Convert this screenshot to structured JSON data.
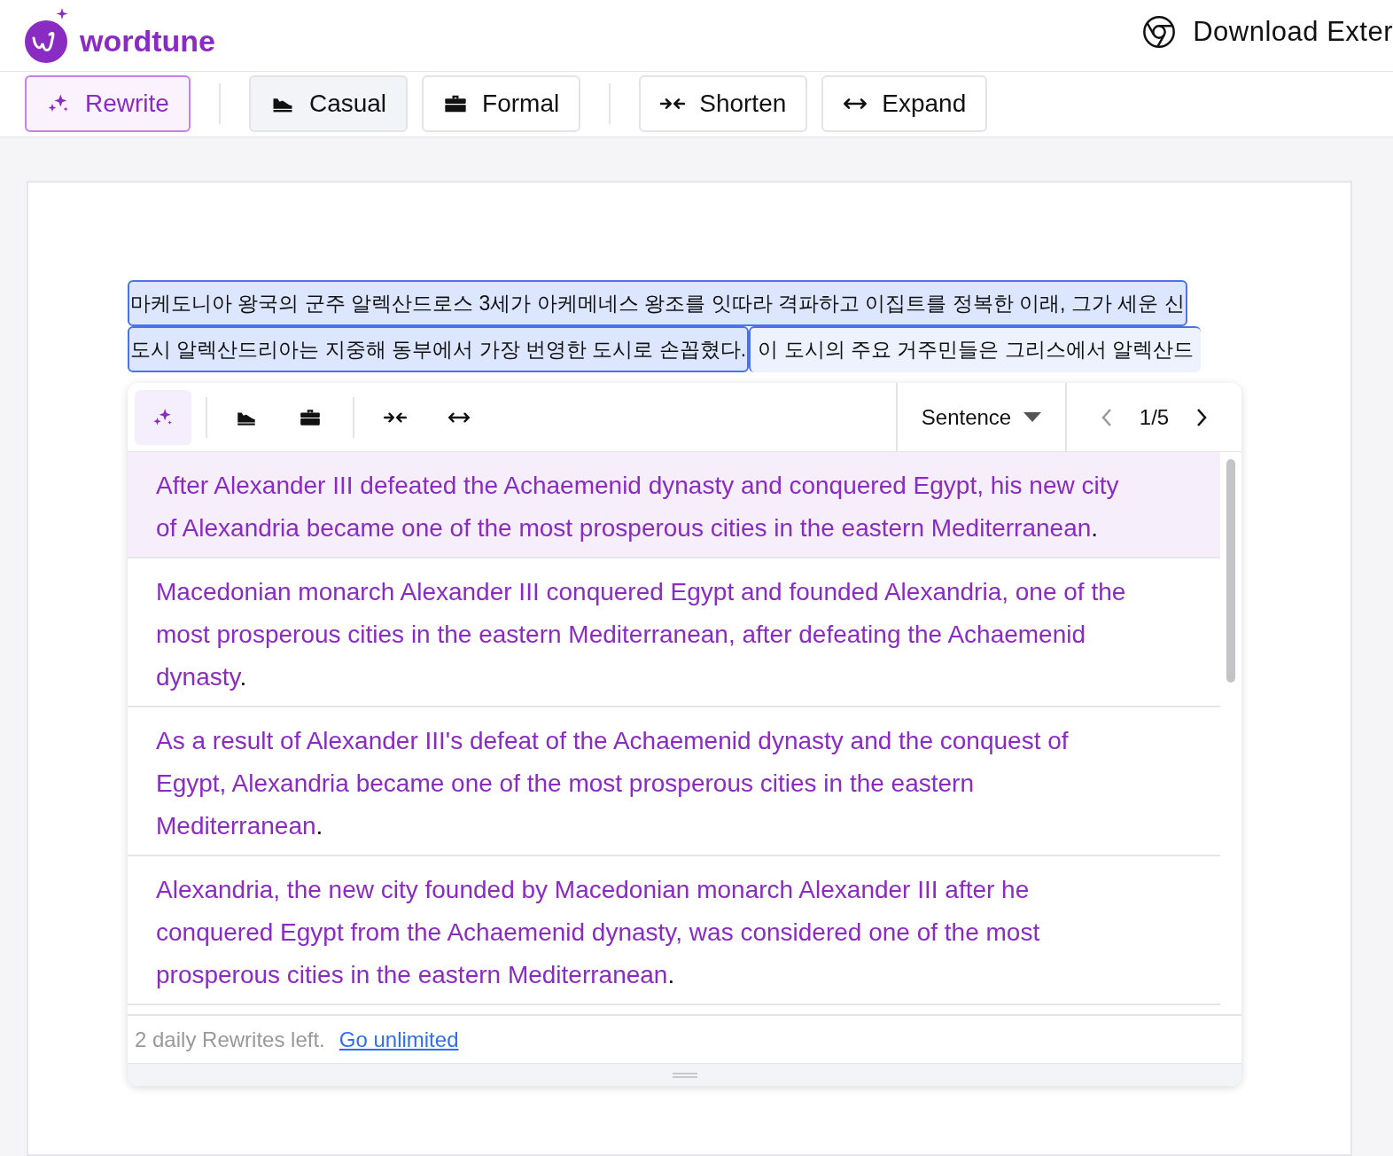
{
  "header": {
    "brand": "wordtune",
    "download_label": "Download Exter"
  },
  "toolbar": [
    {
      "kind": "rewrite",
      "label": "Rewrite",
      "selected": true
    },
    {
      "kind": "casual",
      "label": "Casual",
      "selected": false
    },
    {
      "kind": "formal",
      "label": "Formal",
      "selected": false
    },
    {
      "kind": "shorten",
      "label": "Shorten",
      "selected": false
    },
    {
      "kind": "expand",
      "label": "Expand",
      "selected": false
    }
  ],
  "editor": {
    "sentences": [
      {
        "selected": true,
        "lines": [
          "마케도니아 왕국의 군주 알렉산드로스 3세가 아케메네스 왕조를 잇따라 격파하고 이집트를 정복한 이래, 그가 세운 신",
          "도시 알렉산드리아는 지중해 동부에서 가장 번영한 도시로 손꼽혔다."
        ]
      },
      {
        "selected": false,
        "lines": [
          "이 도시의 주요 거주민들은 그리스에서 알렉산드"
        ]
      }
    ]
  },
  "popup": {
    "tools": [
      {
        "kind": "rewrite",
        "selected": true
      },
      {
        "kind": "casual",
        "selected": false
      },
      {
        "kind": "formal",
        "selected": false
      },
      {
        "kind": "shorten",
        "selected": false
      },
      {
        "kind": "expand",
        "selected": false
      }
    ],
    "mode": "Sentence",
    "pager": "1/5",
    "suggestions": [
      {
        "text": "After Alexander III defeated the Achaemenid dynasty and conquered Egypt, his new city of Alexandria became one of the most prosperous cities in the eastern Mediterranean",
        "end": ".",
        "selected": true
      },
      {
        "text": "Macedonian monarch Alexander III conquered Egypt and founded Alexandria, one of the most prosperous cities in the eastern Mediterranean, after defeating the Achaemenid dynasty",
        "end": ".",
        "selected": false
      },
      {
        "text": "As a result of Alexander III's defeat of the Achaemenid dynasty and the conquest of Egypt, Alexandria became one of the most prosperous cities in the eastern Mediterranean",
        "end": ".",
        "selected": false
      },
      {
        "text": "Alexandria, the new city founded by Macedonian monarch Alexander III after he conquered Egypt from the Achaemenid dynasty, was considered one of the most prosperous cities in the eastern Mediterranean",
        "end": ".",
        "selected": false
      }
    ],
    "footer_note": "2 daily Rewrites left.",
    "footer_link": "Go unlimited"
  }
}
